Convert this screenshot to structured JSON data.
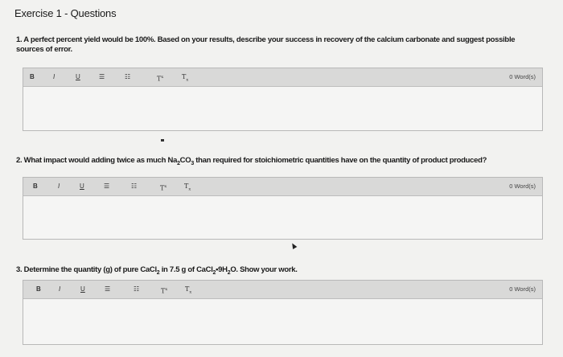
{
  "page": {
    "title": "Exercise 1 - Questions"
  },
  "toolbar": {
    "bold": "B",
    "italic": "I",
    "underline": "U",
    "ordered_list": "☰",
    "unordered_list": "☷",
    "superscript": "T",
    "subscript": "T",
    "word_count": "0 Word(s)"
  },
  "questions": [
    {
      "text": "1. A perfect percent yield would be 100%. Based on your results, describe your success in recovery of the calcium carbonate and suggest possible sources of error."
    },
    {
      "text_before": "2. What impact would adding twice as much Na",
      "sub1": "2",
      "text_mid": "CO",
      "sub2": "3",
      "text_after": " than required for stoichiometric quantities have on the quantity of product produced?"
    },
    {
      "text_a": "3. Determine the quantity (g) of pure CaCl",
      "sub_a": "2",
      "text_b": " in 7.5 g of CaCl",
      "sub_b": "2",
      "text_c": "•9H",
      "sub_c": "2",
      "text_d": "O. Show your work."
    }
  ]
}
